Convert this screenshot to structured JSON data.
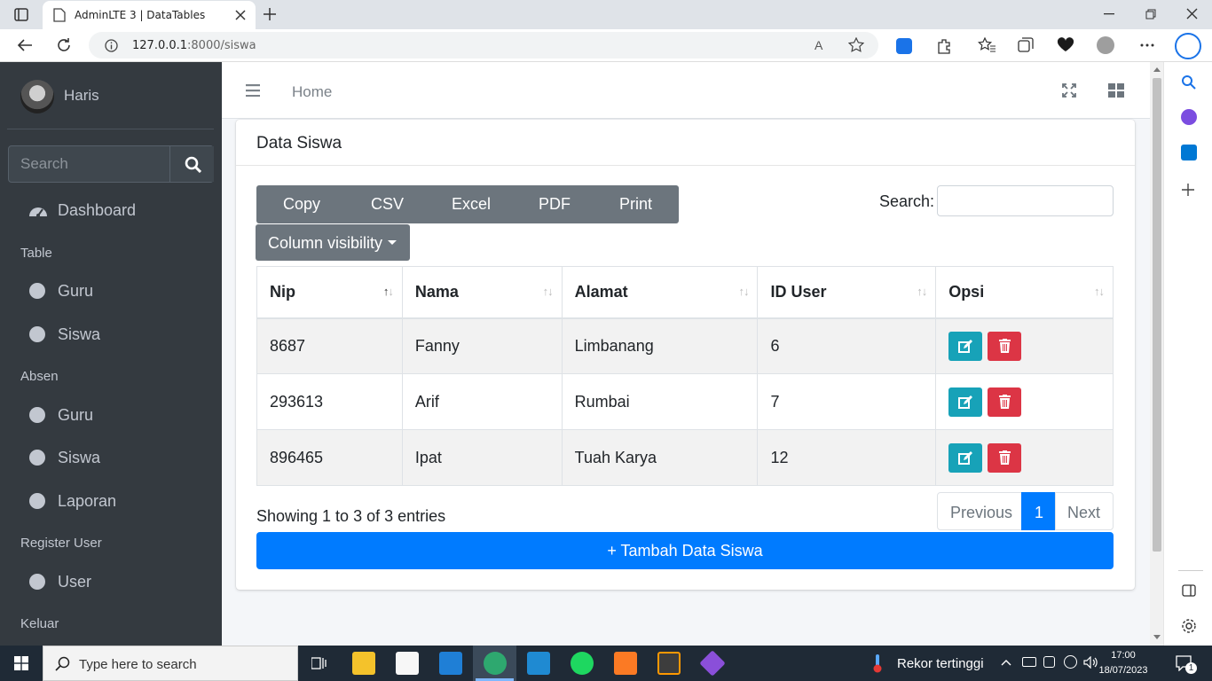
{
  "browser": {
    "tab_title": "AdminLTE 3 | DataTables",
    "url_host": "127.0.0.1",
    "url_path": ":8000/siswa"
  },
  "sidebar": {
    "user_name": "Haris",
    "search_placeholder": "Search",
    "dashboard": "Dashboard",
    "sections": {
      "table": "Table",
      "absen": "Absen",
      "register": "Register User",
      "keluar": "Keluar"
    },
    "table_items": [
      "Guru",
      "Siswa"
    ],
    "absen_items": [
      "Guru",
      "Siswa",
      "Laporan"
    ],
    "register_items": [
      "User"
    ]
  },
  "navbar": {
    "home": "Home"
  },
  "card": {
    "title": "Data Siswa",
    "buttons": [
      "Copy",
      "CSV",
      "Excel",
      "PDF",
      "Print"
    ],
    "column_visibility": "Column visibility",
    "search_label": "Search:",
    "columns": [
      "Nip",
      "Nama",
      "Alamat",
      "ID User",
      "Opsi"
    ],
    "rows": [
      {
        "nip": "8687",
        "nama": "Fanny",
        "alamat": "Limbanang",
        "id_user": "6"
      },
      {
        "nip": "293613",
        "nama": "Arif",
        "alamat": "Rumbai",
        "id_user": "7"
      },
      {
        "nip": "896465",
        "nama": "Ipat",
        "alamat": "Tuah Karya",
        "id_user": "12"
      }
    ],
    "info": "Showing 1 to 3 of 3 entries",
    "pagination": {
      "previous": "Previous",
      "current": "1",
      "next": "Next"
    },
    "add_button": "+ Tambah Data Siswa"
  },
  "taskbar": {
    "search_placeholder": "Type here to search",
    "weather": "Rekor tertinggi",
    "time": "17:00",
    "date": "18/07/2023",
    "notifications": "1"
  },
  "colors": {
    "sidebar_bg": "#343a40",
    "primary": "#007bff",
    "info": "#17a2b8",
    "danger": "#dc3545",
    "secondary": "#6c757d"
  }
}
